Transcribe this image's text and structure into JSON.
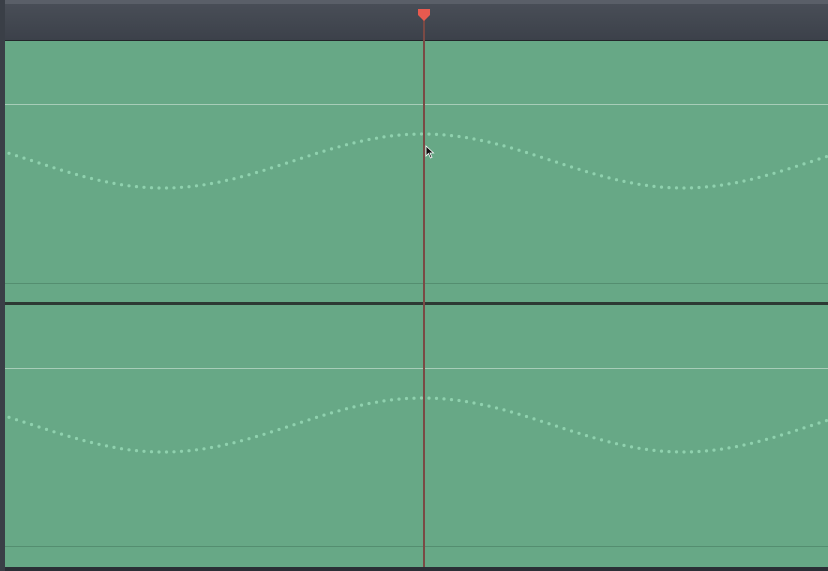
{
  "app": {
    "view": "automation-curve-editor"
  },
  "colors": {
    "track_fill": "#67a886",
    "curve_dot": "#8fd1ae",
    "playhead": "#7a4a45",
    "playhead_marker": "#e85a4f",
    "ruler": "#3f444d"
  },
  "tracks": [
    {
      "id": "track-1",
      "curve": "sine",
      "peak_position": 0.51,
      "amplitude": 0.2
    },
    {
      "id": "track-2",
      "curve": "sine",
      "peak_position": 0.51,
      "amplitude": 0.2
    }
  ],
  "playhead": {
    "icon": "playhead-marker-icon",
    "position": 0.51
  },
  "cursor": {
    "icon": "arrow-pointer-icon"
  }
}
